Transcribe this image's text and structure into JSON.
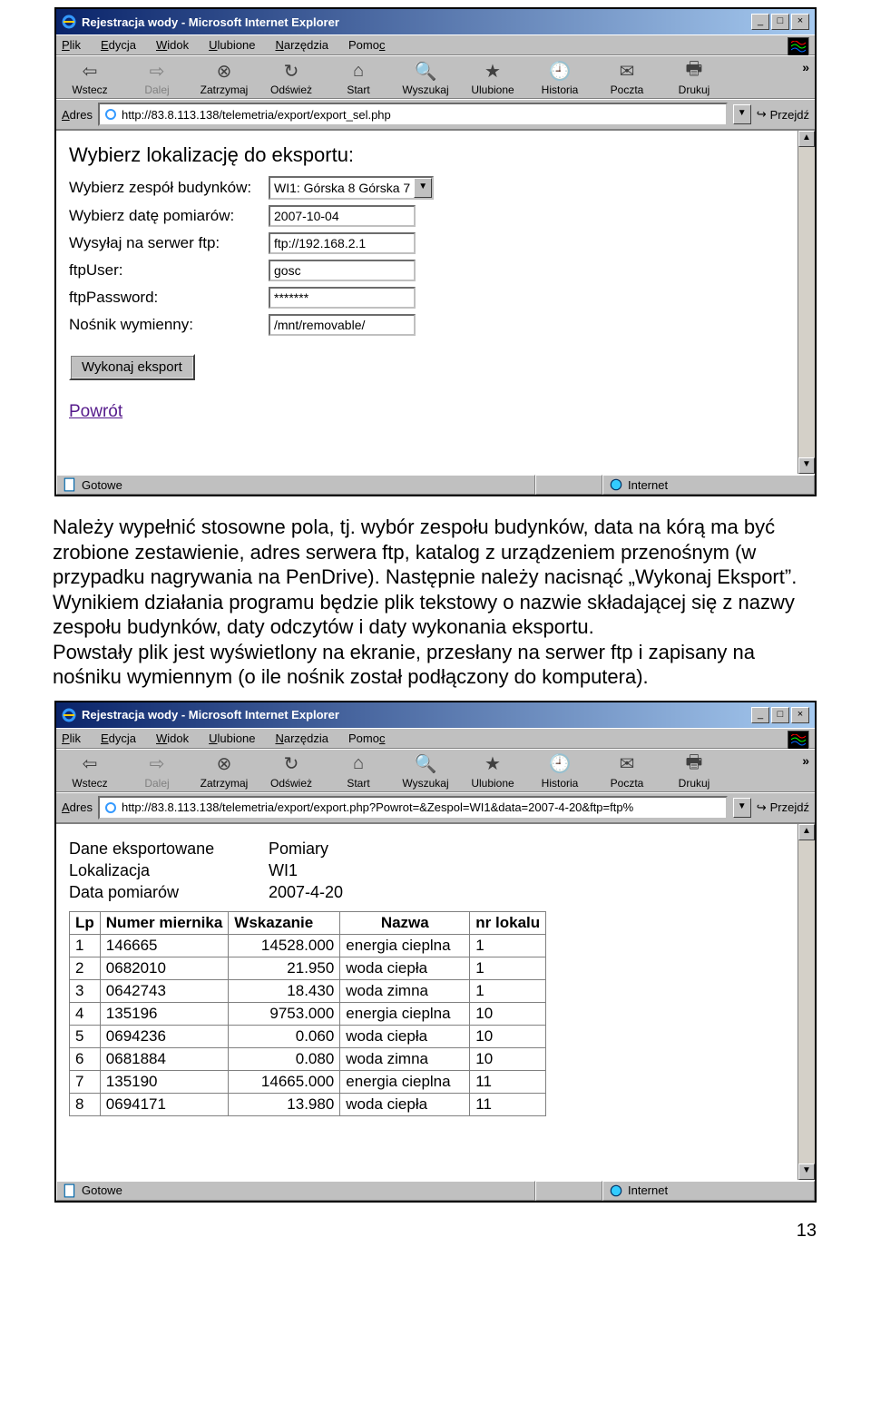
{
  "ie_common": {
    "menu": {
      "plik": "Plik",
      "edycja": "Edycja",
      "widok": "Widok",
      "ulubione": "Ulubione",
      "narzedzia": "Narzędzia",
      "pomoc": "Pomoc"
    },
    "toolbar": {
      "wstecz": "Wstecz",
      "dalej": "Dalej",
      "zatrzymaj": "Zatrzymaj",
      "odswiez": "Odśwież",
      "start": "Start",
      "wyszukaj": "Wyszukaj",
      "ulubione": "Ulubione",
      "historia": "Historia",
      "poczta": "Poczta",
      "drukuj": "Drukuj"
    },
    "address_label": "Adres",
    "go_label": "Przejdź"
  },
  "window1": {
    "title": "Rejestracja wody - Microsoft Internet Explorer",
    "url": "http://83.8.113.138/telemetria/export/export_sel.php",
    "status_left": "Gotowe",
    "status_right": "Internet",
    "page": {
      "heading": "Wybierz lokalizację do eksportu:",
      "rows": {
        "zespol_label": "Wybierz zespół budynków:",
        "zespol_value": "WI1: Górska 8 Górska 7",
        "data_label": "Wybierz datę pomiarów:",
        "data_value": "2007-10-04",
        "ftp_label": "Wysyłaj na serwer ftp:",
        "ftp_value": "ftp://192.168.2.1",
        "ftpuser_label": "ftpUser:",
        "ftpuser_value": "gosc",
        "ftppass_label": "ftpPassword:",
        "ftppass_value": "*******",
        "nosnik_label": "Nośnik wymienny:",
        "nosnik_value": "/mnt/removable/"
      },
      "submit": "Wykonaj eksport",
      "back_link": "Powrót"
    }
  },
  "paragraph": "Należy wypełnić stosowne pola, tj. wybór zespołu budynków, data na kórą ma być zrobione zestawienie, adres serwera ftp, katalog z urządzeniem przenośnym (w przypadku nagrywania na PenDrive). Następnie należy nacisnąć „Wykonaj Eksport”. Wynikiem działania programu będzie plik tekstowy o nazwie składającej się z nazwy zespołu budynków, daty odczytów i daty wykonania eksportu.\nPowstały plik jest wyświetlony na ekranie, przesłany na serwer ftp i zapisany na nośniku wymiennym (o ile nośnik został podłączony do komputera).",
  "window2": {
    "title": "Rejestracja wody - Microsoft Internet Explorer",
    "url": "http://83.8.113.138/telemetria/export/export.php?Powrot=&Zespol=WI1&data=2007-4-20&ftp=ftp%",
    "status_left": "Gotowe",
    "status_right": "Internet",
    "page": {
      "info1_label": "Dane eksportowane",
      "info1_value": "Pomiary",
      "info2_label": "Lokalizacja",
      "info2_value": "WI1",
      "info3_label": "Data pomiarów",
      "info3_value": "2007-4-20",
      "headers": {
        "lp": "Lp",
        "numer": "Numer miernika",
        "wskazanie": "Wskazanie",
        "nazwa": "Nazwa",
        "lokal": "nr lokalu"
      },
      "rows": [
        {
          "lp": "1",
          "numer": "146665",
          "wskazanie": "14528.000",
          "nazwa": "energia cieplna",
          "lokal": "1"
        },
        {
          "lp": "2",
          "numer": "0682010",
          "wskazanie": "21.950",
          "nazwa": "woda ciepła",
          "lokal": "1"
        },
        {
          "lp": "3",
          "numer": "0642743",
          "wskazanie": "18.430",
          "nazwa": "woda zimna",
          "lokal": "1"
        },
        {
          "lp": "4",
          "numer": "135196",
          "wskazanie": "9753.000",
          "nazwa": "energia cieplna",
          "lokal": "10"
        },
        {
          "lp": "5",
          "numer": "0694236",
          "wskazanie": "0.060",
          "nazwa": "woda ciepła",
          "lokal": "10"
        },
        {
          "lp": "6",
          "numer": "0681884",
          "wskazanie": "0.080",
          "nazwa": "woda zimna",
          "lokal": "10"
        },
        {
          "lp": "7",
          "numer": "135190",
          "wskazanie": "14665.000",
          "nazwa": "energia cieplna",
          "lokal": "11"
        },
        {
          "lp": "8",
          "numer": "0694171",
          "wskazanie": "13.980",
          "nazwa": "woda ciepła",
          "lokal": "11"
        }
      ]
    }
  },
  "page_number": "13"
}
